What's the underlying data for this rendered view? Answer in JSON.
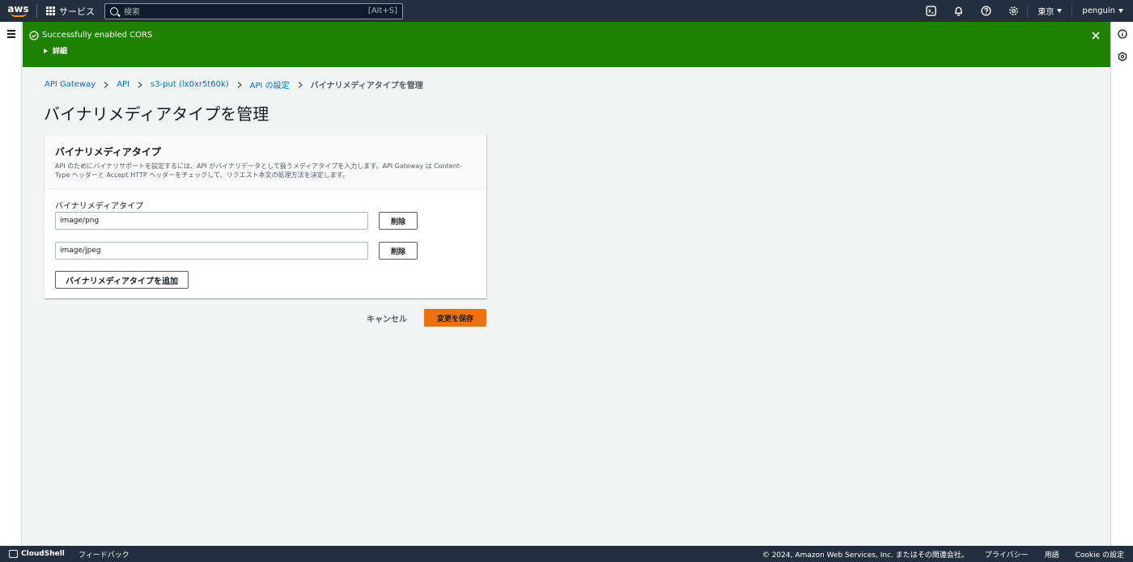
{
  "topnav": {
    "logo": "aws",
    "services_label": "サービス",
    "search_placeholder": "検索",
    "search_shortcut": "[Alt+S]",
    "region": "東京",
    "user": "penguin"
  },
  "flash": {
    "message": "Successfully enabled CORS",
    "details_label": "詳細",
    "color": "#1d8102"
  },
  "breadcrumb": {
    "items": [
      "API Gateway",
      "API",
      "s3-put (lx0xr5t60k)",
      "API の設定"
    ],
    "current": "バイナリメディアタイプを管理"
  },
  "page_title": "バイナリメディアタイプを管理",
  "container": {
    "title": "バイナリメディアタイプ",
    "description": "API のためにバイナリサポートを設定するには、API がバイナリデータとして扱うメディアタイプを入力します。API Gateway は Content-Type ヘッダーと Accept HTTP ヘッダーをチェックして、リクエスト本文の処理方法を決定します。",
    "field_label": "バイナリメディアタイプ",
    "media_types": [
      {
        "value": "image/png",
        "remove_label": "削除"
      },
      {
        "value": "image/jpeg",
        "remove_label": "削除"
      }
    ],
    "add_label": "バイナリメディアタイプを追加"
  },
  "actions": {
    "cancel_label": "キャンセル",
    "save_label": "変更を保存",
    "save_color": "#ec7211"
  },
  "footer": {
    "cloudshell": "CloudShell",
    "feedback": "フィードバック",
    "copyright": "© 2024, Amazon Web Services, Inc. またはその関連会社。",
    "privacy": "プライバシー",
    "terms": "用語",
    "cookie": "Cookie の設定"
  }
}
